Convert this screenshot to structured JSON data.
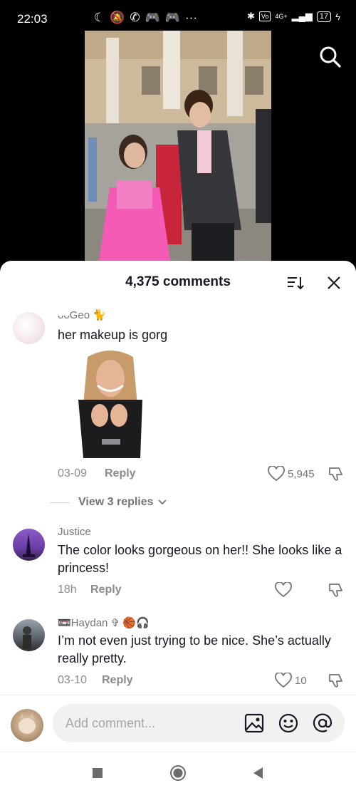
{
  "status_bar": {
    "time": "22:03",
    "battery": "17",
    "network": "4G+"
  },
  "video": {
    "description": "prom photo"
  },
  "sheet": {
    "title": "4,375 comments"
  },
  "comments": [
    {
      "username": "ᴗᴗGeo 🐈",
      "text": "her makeup is gorg",
      "sticker": "gif",
      "date": "03-09",
      "reply_label": "Reply",
      "likes": "5,945",
      "view_replies": "View 3 replies"
    },
    {
      "username": "Justice",
      "text": "The color looks gorgeous on her!! She looks like a princess!",
      "date": "18h",
      "reply_label": "Reply",
      "likes": ""
    },
    {
      "username": "📼Haydan ✞ 🏀🎧",
      "text": "I’m not even just trying to be nice. She’s actually really pretty.",
      "date": "03-10",
      "reply_label": "Reply",
      "likes": "10"
    }
  ],
  "input": {
    "placeholder": "Add comment..."
  },
  "colors": {
    "accent_text": "#161823",
    "muted": "#8a8b91",
    "sheet_bg": "#ffffff"
  }
}
